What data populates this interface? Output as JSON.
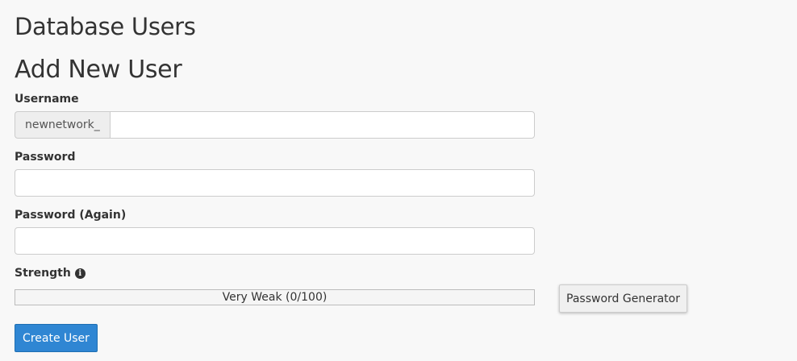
{
  "page": {
    "section_title": "Database Users",
    "form_title": "Add New User"
  },
  "form": {
    "username": {
      "label": "Username",
      "prefix": "newnetwork_",
      "value": ""
    },
    "password": {
      "label": "Password",
      "value": ""
    },
    "password_again": {
      "label": "Password (Again)",
      "value": ""
    },
    "strength": {
      "label": "Strength",
      "info_icon": "info-circle-icon",
      "text": "Very Weak (0/100)",
      "score": 0,
      "max": 100
    },
    "password_generator_label": "Password Generator",
    "create_user_label": "Create User"
  },
  "colors": {
    "primary_button": "#2f86d3",
    "background": "#f8f8f8"
  }
}
